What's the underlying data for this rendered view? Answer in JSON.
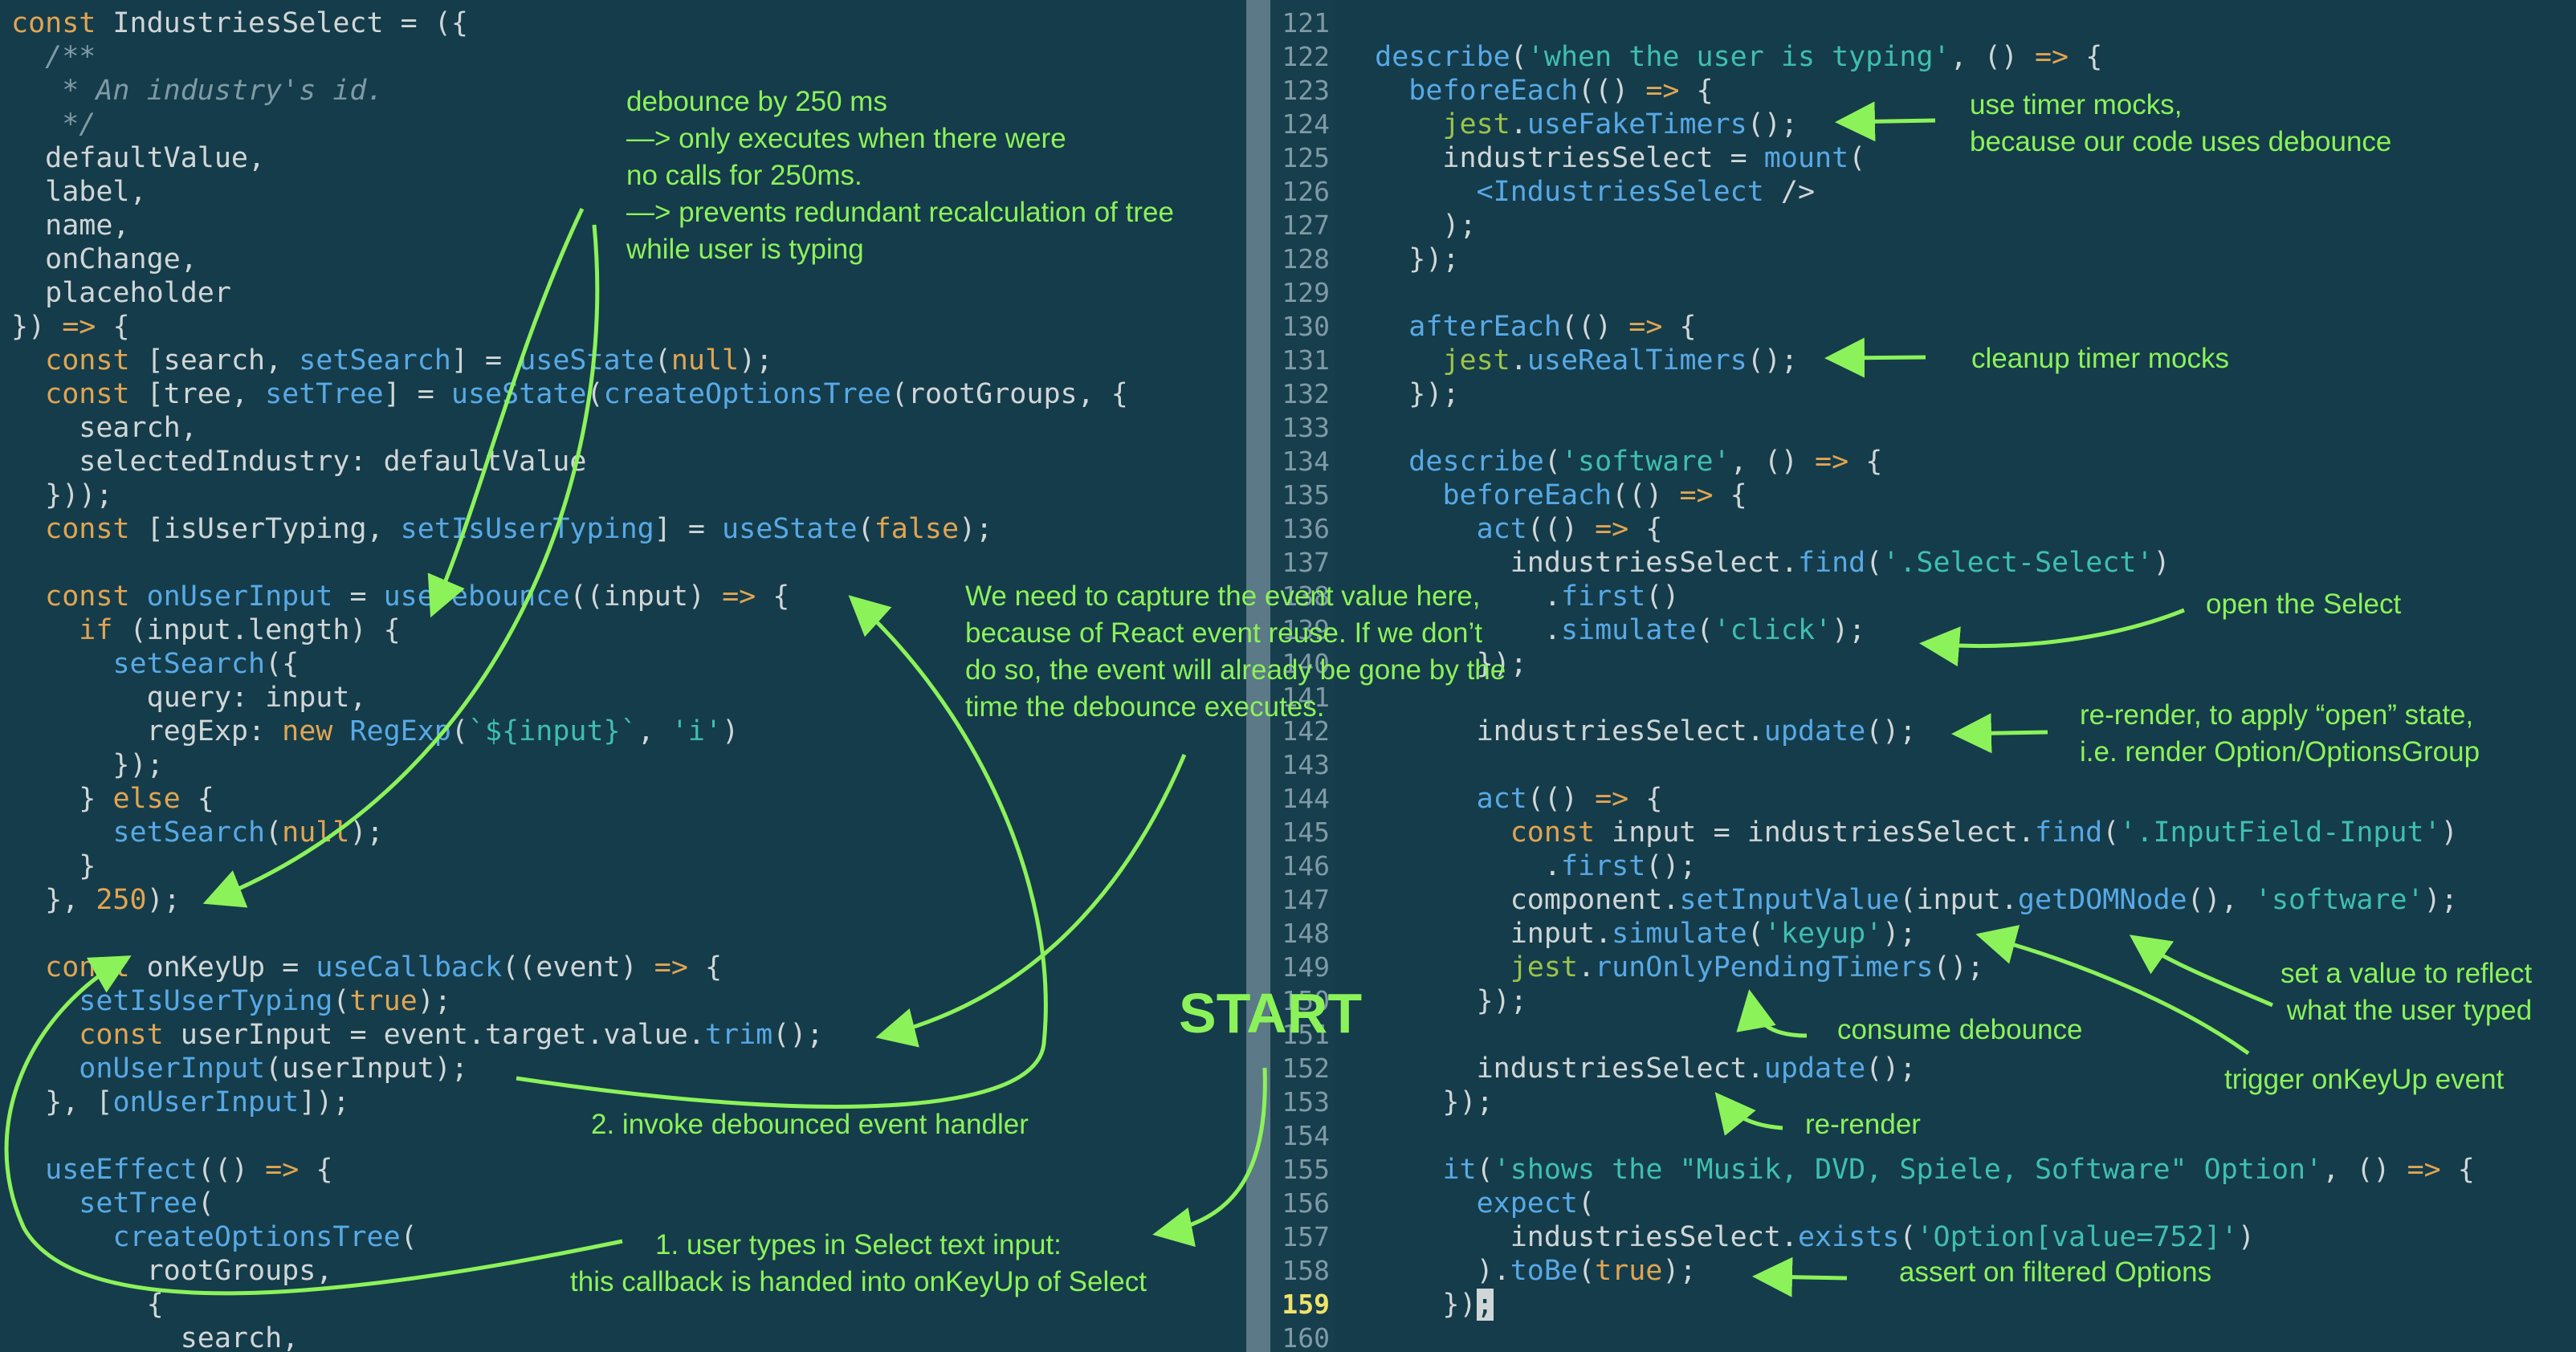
{
  "left_code": [
    "const IndustriesSelect = ({",
    "  /**",
    "   * An industry's id.",
    "   */",
    "  defaultValue,",
    "  label,",
    "  name,",
    "  onChange,",
    "  placeholder",
    "}) => {",
    "  const [search, setSearch] = useState(null);",
    "  const [tree, setTree] = useState(createOptionsTree(rootGroups, {",
    "    search,",
    "    selectedIndustry: defaultValue",
    "  }));",
    "  const [isUserTyping, setIsUserTyping] = useState(false);",
    "",
    "  const onUserInput = useDebounce((input) => {",
    "    if (input.length) {",
    "      setSearch({",
    "        query: input,",
    "        regExp: new RegExp(`${input}`, 'i')",
    "      });",
    "    } else {",
    "      setSearch(null);",
    "    }",
    "  }, 250);",
    "",
    "  const onKeyUp = useCallback((event) => {",
    "    setIsUserTyping(true);",
    "    const userInput = event.target.value.trim();",
    "    onUserInput(userInput);",
    "  }, [onUserInput]);",
    "",
    "  useEffect(() => {",
    "    setTree(",
    "      createOptionsTree(",
    "        rootGroups,",
    "        {",
    "          search,"
  ],
  "right_line_numbers": [
    "121",
    "122",
    "123",
    "124",
    "125",
    "126",
    "127",
    "128",
    "129",
    "130",
    "131",
    "132",
    "133",
    "134",
    "135",
    "136",
    "137",
    "138",
    "139",
    "140",
    "141",
    "142",
    "143",
    "144",
    "145",
    "146",
    "147",
    "148",
    "149",
    "150",
    "151",
    "152",
    "153",
    "154",
    "155",
    "156",
    "157",
    "158",
    "159",
    "160"
  ],
  "current_line": "159",
  "right_code": [
    "",
    "  describe('when the user is typing', () => {",
    "    beforeEach(() => {",
    "      jest.useFakeTimers();",
    "      industriesSelect = mount(",
    "        <IndustriesSelect />",
    "      );",
    "    });",
    "",
    "    afterEach(() => {",
    "      jest.useRealTimers();",
    "    });",
    "",
    "    describe('software', () => {",
    "      beforeEach(() => {",
    "        act(() => {",
    "          industriesSelect.find('.Select-Select')",
    "            .first()",
    "            .simulate('click');",
    "        });",
    "",
    "        industriesSelect.update();",
    "",
    "        act(() => {",
    "          const input = industriesSelect.find('.InputField-Input')",
    "            .first();",
    "          component.setInputValue(input.getDOMNode(), 'software');",
    "          input.simulate('keyup');",
    "          jest.runOnlyPendingTimers();",
    "        });",
    "",
    "        industriesSelect.update();",
    "      });",
    "",
    "      it('shows the \"Musik, DVD, Spiele, Software\" Option', () => {",
    "        expect(",
    "          industriesSelect.exists('Option[value=752]')",
    "        ).toBe(true);",
    "      });",
    ""
  ],
  "annotations": {
    "debounce": "debounce by 250 ms\n—> only executes when there were\nno calls for 250ms.\n—> prevents redundant recalculation of tree\nwhile user is typing",
    "capture_event": "We need to capture the event value here,\nbecause of React event reuse. If we don’t\ndo so, the event will already be gone by the\ntime the debounce executes.",
    "invoke_handler": "2. invoke debounced event handler",
    "user_types": "1. user types in Select text input:\nthis callback is handed into onKeyUp of Select",
    "start": "START",
    "timer_mocks": "use timer mocks,\nbecause our code uses debounce",
    "cleanup": "cleanup timer mocks",
    "open_select": "open the Select",
    "rerender_open": "re-render, to apply “open” state,\ni.e. render Option/OptionsGroup",
    "set_value": "set a value to reflect\nwhat the user typed",
    "consume_debounce": "consume debounce",
    "trigger_keyup": "trigger onKeyUp event",
    "rerender": "re-render",
    "assert": "assert on filtered Options"
  },
  "colors": {
    "background": "#153c4a",
    "annotation": "#8cf25a",
    "keyword": "#e0a553",
    "function": "#58a9e6",
    "string": "#3fbfae",
    "comment": "#7f9aa6",
    "current_line_number": "#f0e36a"
  }
}
